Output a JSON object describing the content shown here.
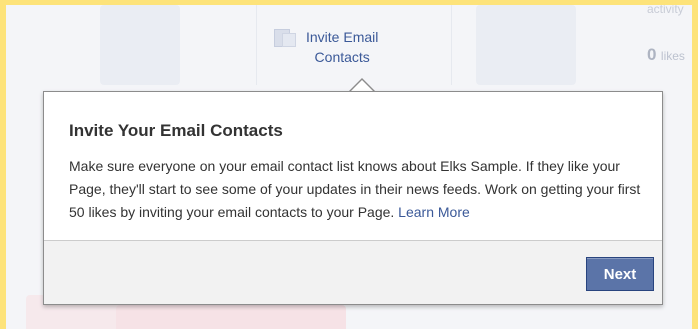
{
  "background": {
    "cut_label": "...",
    "invite_link": {
      "line1": "Invite Email",
      "line2": "Contacts",
      "icon": "contacts-card-icon"
    },
    "activity_label": "activity",
    "likes": {
      "count": "0",
      "label": "likes"
    }
  },
  "popup": {
    "title": "Invite Your Email Contacts",
    "body": "Make sure everyone on your email contact list knows about Elks Sample. If they like your Page, they'll start to see some of your updates in their news feeds. Work on getting your first 50 likes by inviting your email contacts to your Page.",
    "learn_more_label": "Learn More",
    "next_button_label": "Next"
  },
  "colors": {
    "frame": "#fde37a",
    "link": "#3b5998",
    "button": "#5b74a8"
  }
}
